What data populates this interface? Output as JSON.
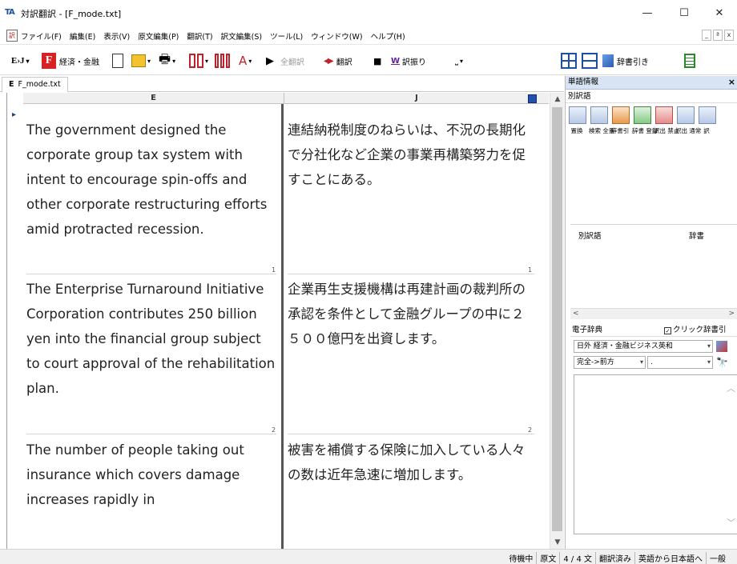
{
  "window": {
    "app_icon": "TA",
    "title": "対訳翻訳 - [F_mode.txt]",
    "minimize": "—",
    "maximize": "☐",
    "close": "✕"
  },
  "menu": {
    "items": [
      "ファイル(F)",
      "編集(E)",
      "表示(V)",
      "原文編集(P)",
      "翻訳(T)",
      "訳文編集(S)",
      "ツール(L)",
      "ウィンドウ(W)",
      "ヘルプ(H)"
    ],
    "mdi_min": "_",
    "mdi_restore": "ª",
    "mdi_close": "x"
  },
  "toolbar": {
    "direction": "E›J",
    "mode_letter": "F",
    "field": "経済・金融",
    "translate_all": "全翻訳",
    "translate": "翻訳",
    "word_assign": "訳振り",
    "dict_lookup": "辞書引き"
  },
  "tab": {
    "letter": "E",
    "name": "F_mode.txt"
  },
  "columns": {
    "en": "E",
    "ja": "J"
  },
  "segments": [
    {
      "en": "The government designed the corporate group tax system with intent to encourage spin-offs and other corporate restructuring efforts amid protracted recession.",
      "ja": "連結納税制度のねらいは、不況の長期化で分社化など企業の事業再構築努力を促すことにある。",
      "num": "1"
    },
    {
      "en": "The Enterprise Turnaround Initiative Corporation contributes 250 billion yen into the financial group subject to court approval of the rehabilitation plan.",
      "ja": "企業再生支援機構は再建計画の裁判所の承認を条件として金融グループの中に２５００億円を出資します。",
      "num": "2"
    },
    {
      "en": "The number of people taking out insurance which covers damage increases rapidly in",
      "ja": "被害を補償する保険に加入している人々の数は近年急速に増加します。",
      "num": ""
    }
  ],
  "word_panel": {
    "title": "単語情報",
    "close": "×",
    "subtab": "別訳語",
    "tool_labels": [
      "置換",
      "検索 全置",
      "辞書引",
      "辞書 登録",
      "訳出 禁止",
      "訳出 通常",
      "訳"
    ],
    "col_alt": "別訳語",
    "col_dict": "辞書"
  },
  "e_dict": {
    "title": "電子辞典",
    "click_lookup": "クリック辞書引",
    "dictionary": "日外 経済・金融ビジネス英和",
    "match": "完全->前方",
    "query": "."
  },
  "status": [
    "待機中",
    "原文",
    "4 / 4 文",
    "翻訳済み",
    "英語から日本語へ",
    "一般"
  ]
}
